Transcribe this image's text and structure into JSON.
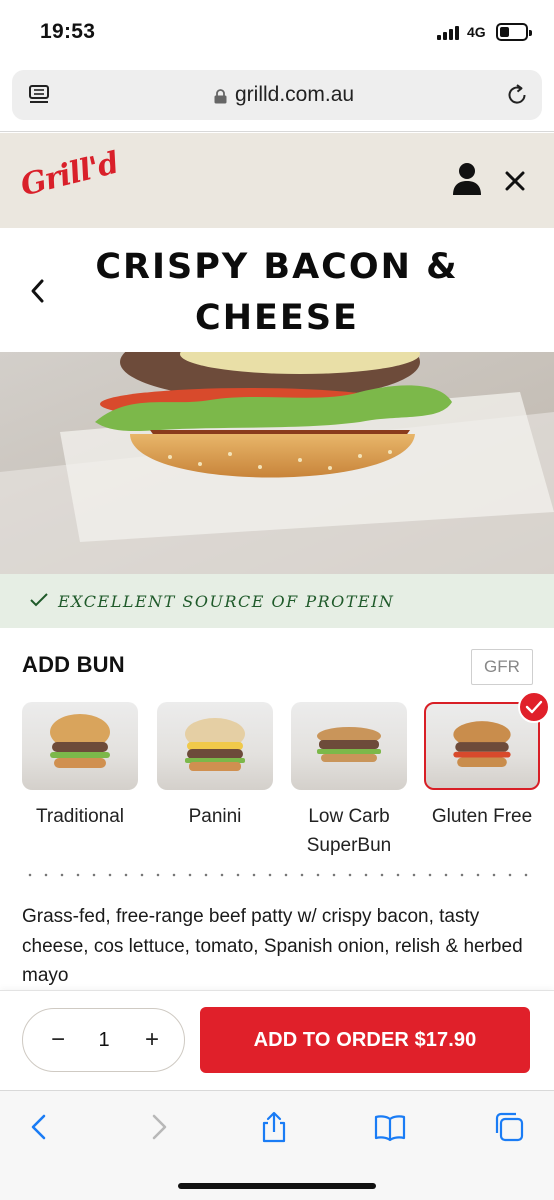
{
  "status": {
    "time": "19:53",
    "network": "4G"
  },
  "browser": {
    "url": "grilld.com.au"
  },
  "header": {
    "logo": "Grill'd"
  },
  "product": {
    "title": "CRISPY BACON & CHEESE",
    "protein_note": "Excellent Source of Protein",
    "description": "Grass-fed, free-range beef patty w/ crispy bacon, tasty cheese, cos lettuce, tomato, Spanish onion, relish & herbed mayo"
  },
  "bun": {
    "heading": "ADD BUN",
    "badge": "GFR",
    "options": [
      {
        "label": "Traditional",
        "selected": false
      },
      {
        "label": "Panini",
        "selected": false
      },
      {
        "label": "Low Carb SuperBun",
        "selected": false
      },
      {
        "label": "Gluten Free",
        "selected": true
      }
    ]
  },
  "order": {
    "quantity": "1",
    "minus": "−",
    "plus": "+",
    "button_label": "ADD TO ORDER $17.90"
  },
  "colors": {
    "brand_red": "#e0202a",
    "header_bg": "#ebe7df",
    "protein_bg": "#e6eee4",
    "safari_blue": "#1a7cf5"
  },
  "icons": [
    "reader-icon",
    "lock-icon",
    "reload-icon",
    "user-icon",
    "close-icon",
    "back-chevron-icon",
    "check-icon",
    "safari-back-icon",
    "safari-forward-icon",
    "share-icon",
    "bookmarks-icon",
    "tabs-icon"
  ]
}
